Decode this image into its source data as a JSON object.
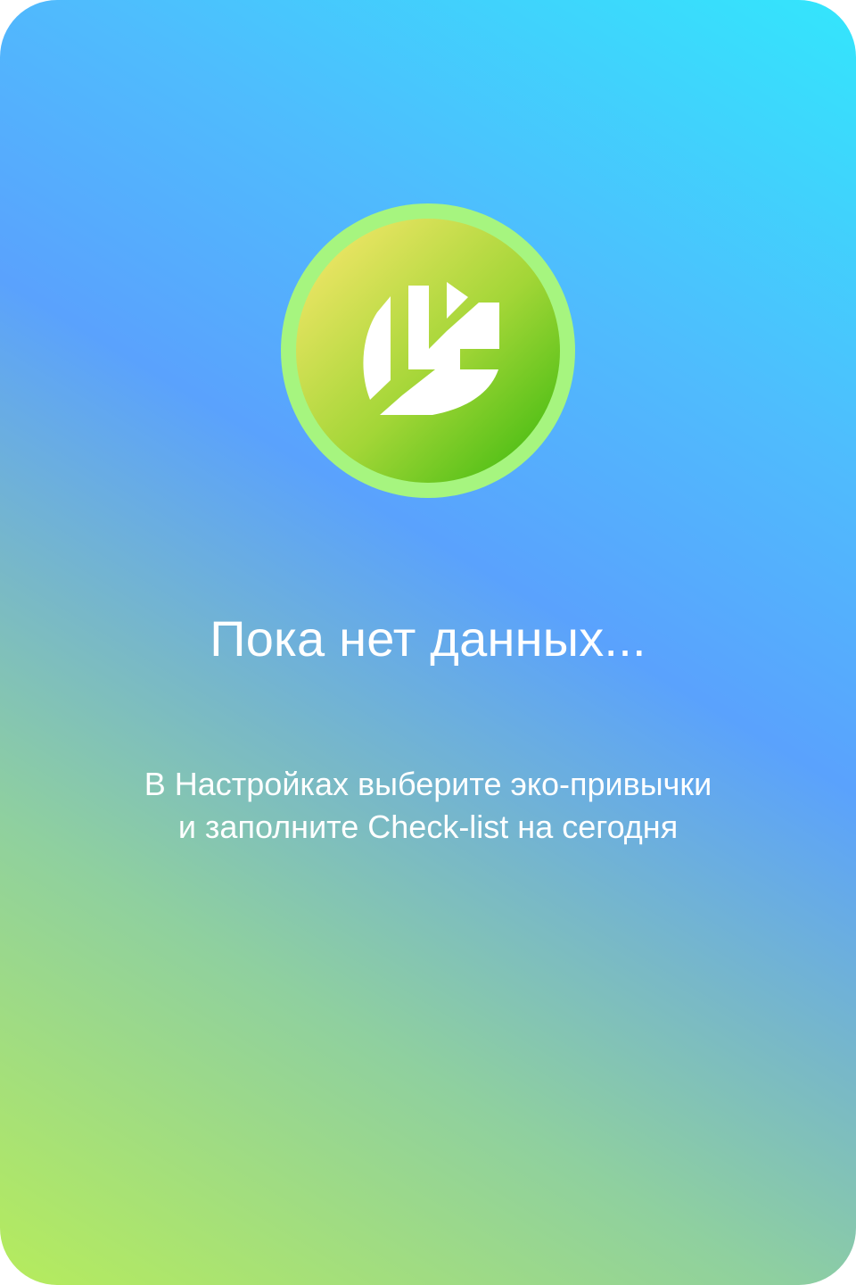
{
  "empty_state": {
    "icon": "leaf-icon",
    "title": "Пока нет данных...",
    "message_lines": [
      "В Настройках выберите эко-привычки",
      "и заполните Check-list на сегодня"
    ]
  },
  "colors": {
    "gradient_top_right": "#33e6fc",
    "gradient_middle": "#5aa2fd",
    "gradient_bottom_left": "#b6ec5c",
    "icon_ring": "#a6f57f",
    "icon_fill_start": "#fde86f",
    "icon_fill_end": "#36b80c",
    "text": "#ffffff"
  }
}
